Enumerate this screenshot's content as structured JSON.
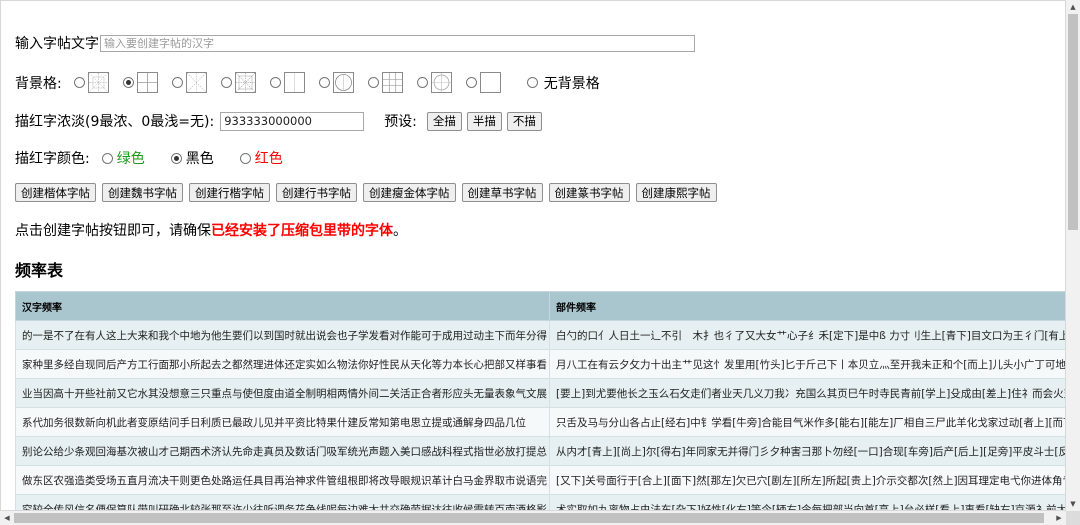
{
  "input": {
    "label": "输入字帖文字",
    "placeholder": "输入要创建字帖的汉字"
  },
  "background": {
    "label": "背景格:",
    "options": [
      "grid-mi",
      "grid-tian",
      "grid-mi-light",
      "grid-mi-dense",
      "grid-square",
      "grid-circle",
      "grid-nine",
      "grid-circle-tian",
      "grid-blank"
    ],
    "selected_index": 1,
    "none_label": "无背景格"
  },
  "density": {
    "label": "描红字浓淡(9最浓、0最浅=无):",
    "value": "933333000000",
    "preset_label": "预设:",
    "presets": [
      "全描",
      "半描",
      "不描"
    ]
  },
  "color": {
    "label": "描红字颜色:",
    "options": [
      {
        "label": "绿色",
        "color": "#1a9a1a",
        "checked": false
      },
      {
        "label": "黑色",
        "color": "#000000",
        "checked": true
      },
      {
        "label": "红色",
        "color": "#ff0000",
        "checked": false
      }
    ]
  },
  "create_buttons": [
    "创建楷体字帖",
    "创建魏书字帖",
    "创建行楷字帖",
    "创建行书字帖",
    "创建瘦金体字帖",
    "创建草书字帖",
    "创建篆书字帖",
    "创建康熙字帖"
  ],
  "notice": {
    "prefix": "点击创建字帖按钮即可，请确保",
    "emphasis": "已经安装了压缩包里带的字体",
    "suffix": "。"
  },
  "freq_title": "频率表",
  "table": {
    "headers": [
      "汉字频率",
      "部件频率"
    ],
    "rows": [
      [
        "的一是不了在有人这上大来和我个中地为他生要们以到国时就出说会也子学发看对作能可于成用过动主下而年分得",
        "白勺的口亻人日土一辶不引　木扌也彳了又大女艹心子纟禾[定下]是中ß 力寸刂生上[青下]目文口为王彳门[有上]以[在"
      ],
      [
        "家种里多经自现同后产方工行面那小所起去之都然理进体还定实如么物法你好性民从天化等力本长心把部又样事看",
        "月八工在有云夕攵力十出主艹见这忄发里用[竹头]匕于斤己下丨本贝立灬至开我未正和个[而上]儿头小广丁可地去京"
      ],
      [
        "业当因高十开些社前又它水其没想意三只重点与使但度由道全制明相两情外间二关活正合者形应头无量表象气文展",
        "[要上]到尤要他长之玉么石攵走们者业天几义刀我冫充国么其页巳午时寺民青前[学上]殳成由[差上]住礻而会火对旦过"
      ],
      [
        "系代加务很数新向机此者变原结问手日利质已最政儿见并平资比特果什建反常知第电思立提或通解身四品几位",
        "只舌及马与分山各占止[经右]中钅学看[牛旁]合能目气米作多[能右][能左]厂相自三尸此羊化戈家过动[者上][而下]手与"
      ],
      [
        "别论公给少条观回海基次被山才己期西术济认先命走真员及数话门吸军统光声题入美口感战科程式指世必放打提总",
        "从内才[青上][尚上]尔[得右]年同家无并得门彡夕种害彐那卜勿经[一口]合现[车旁]后产[后上][足旁]平皮斗士[反外]元"
      ],
      [
        "做东区农强造类受场五直月流决干则更色处路运任具目再治神求件管组根即将改导眼规识革计白马金界取市说语完",
        "[又下]关号面行于[合上][面下]然[那左]欠已穴[剧左][所左]所起[贵上]介示交都次[然上]因耳理定电弋你进体角专还千"
      ],
      [
        "究较全传风信名便保算队带叫研确北较张那至许少往听调务花争线呢每边难太共交确劳据达往收候需转百南酒格影",
        "术实取如九离物占虫法东[杂下]好性[化右]等今[辆右]令每把部当向首[亨上]台必样[看上]事看[缺右]京源衤前太[角上]"
      ]
    ]
  }
}
